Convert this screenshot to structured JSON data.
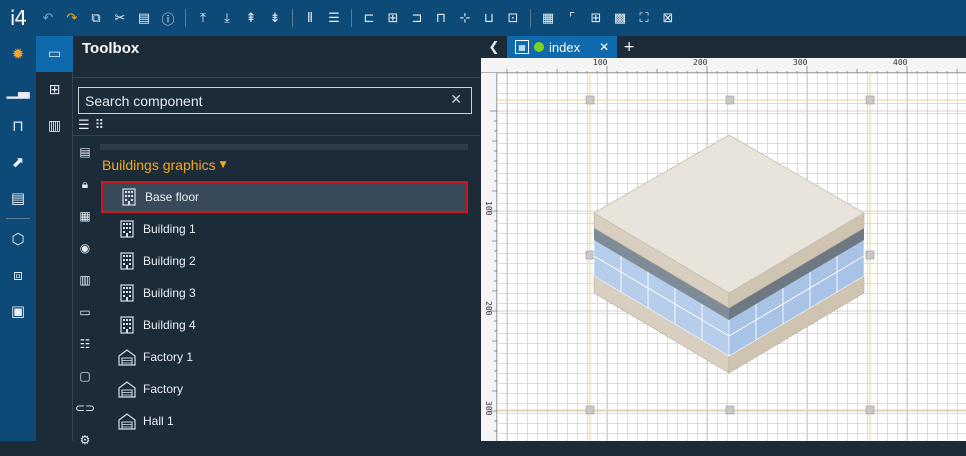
{
  "app": {
    "logo_text": "i4"
  },
  "toolbar": {
    "buttons": [
      {
        "name": "undo-icon",
        "glyph": "↶"
      },
      {
        "name": "redo-icon",
        "glyph": "↷"
      },
      {
        "name": "copy-icon",
        "glyph": "⧉"
      },
      {
        "name": "cut-icon",
        "glyph": "✂"
      },
      {
        "name": "paste-icon",
        "glyph": "📋"
      },
      {
        "name": "info-icon",
        "glyph": "ⓘ"
      }
    ]
  },
  "toolbox": {
    "title": "Toolbox",
    "search_placeholder": "Search component",
    "category": "Buildings graphics",
    "items": [
      {
        "label": "Base floor",
        "icon": "building-icon"
      },
      {
        "label": "Building 1",
        "icon": "building-icon"
      },
      {
        "label": "Building 2",
        "icon": "building-icon"
      },
      {
        "label": "Building 3",
        "icon": "building-icon"
      },
      {
        "label": "Building 4",
        "icon": "building-icon"
      },
      {
        "label": "Factory 1",
        "icon": "factory-icon"
      },
      {
        "label": "Factory",
        "icon": "factory-icon"
      },
      {
        "label": "Hall 1",
        "icon": "factory-icon"
      }
    ]
  },
  "editor": {
    "tab_label": "index",
    "tab_status_color": "#7ed321",
    "ruler_top": [
      "100",
      "200",
      "300",
      "400"
    ],
    "ruler_left": [
      "100",
      "200",
      "300"
    ]
  },
  "colors": {
    "brand": "#0e4a78",
    "accent": "#f5a623",
    "selection": "#d0161b",
    "tab_active": "#0e6aad"
  }
}
